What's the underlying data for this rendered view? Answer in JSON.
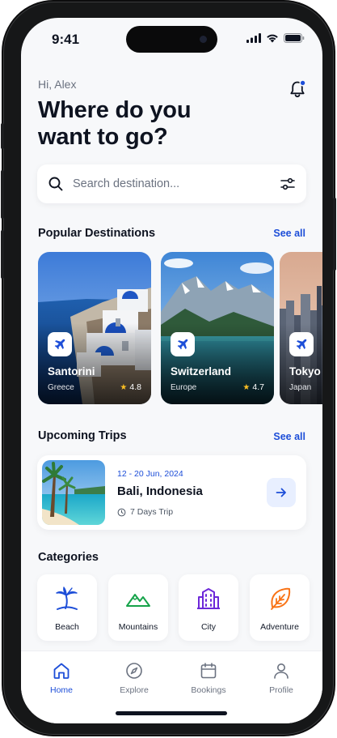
{
  "status_bar": {
    "time": "9:41"
  },
  "header": {
    "greeting": "Hi, Alex",
    "headline_line1": "Where do you",
    "headline_line2": "want to go?"
  },
  "search": {
    "placeholder": "Search destination..."
  },
  "popular": {
    "title": "Popular Destinations",
    "see_all": "See all",
    "items": [
      {
        "name": "Santorini",
        "region": "Greece",
        "rating": "4.8"
      },
      {
        "name": "Switzerland",
        "region": "Europe",
        "rating": "4.7"
      },
      {
        "name": "Tokyo",
        "region": "Japan",
        "rating": ""
      }
    ]
  },
  "upcoming": {
    "title": "Upcoming Trips",
    "see_all": "See all",
    "trip": {
      "dates": "12 - 20 Jun, 2024",
      "place": "Bali, Indonesia",
      "duration": "7 Days Trip"
    }
  },
  "categories": {
    "title": "Categories",
    "items": [
      {
        "label": "Beach",
        "icon": "palm-tree-icon",
        "color": "#1d4ed8"
      },
      {
        "label": "Mountains",
        "icon": "mountain-icon",
        "color": "#16a34a"
      },
      {
        "label": "City",
        "icon": "building-icon",
        "color": "#6d28d9"
      },
      {
        "label": "Adventure",
        "icon": "leaf-icon",
        "color": "#f97316"
      }
    ]
  },
  "nav": {
    "items": [
      {
        "label": "Home",
        "icon": "home-icon",
        "active": true
      },
      {
        "label": "Explore",
        "icon": "compass-icon",
        "active": false
      },
      {
        "label": "Bookings",
        "icon": "calendar-icon",
        "active": false
      },
      {
        "label": "Profile",
        "icon": "user-icon",
        "active": false
      }
    ]
  },
  "colors": {
    "accent": "#1d4ed8",
    "accent_soft": "#e8efff",
    "text": "#0e1320",
    "muted": "#6b7280",
    "star": "#fbbf24",
    "notification_dot": "#1d4ed8"
  }
}
